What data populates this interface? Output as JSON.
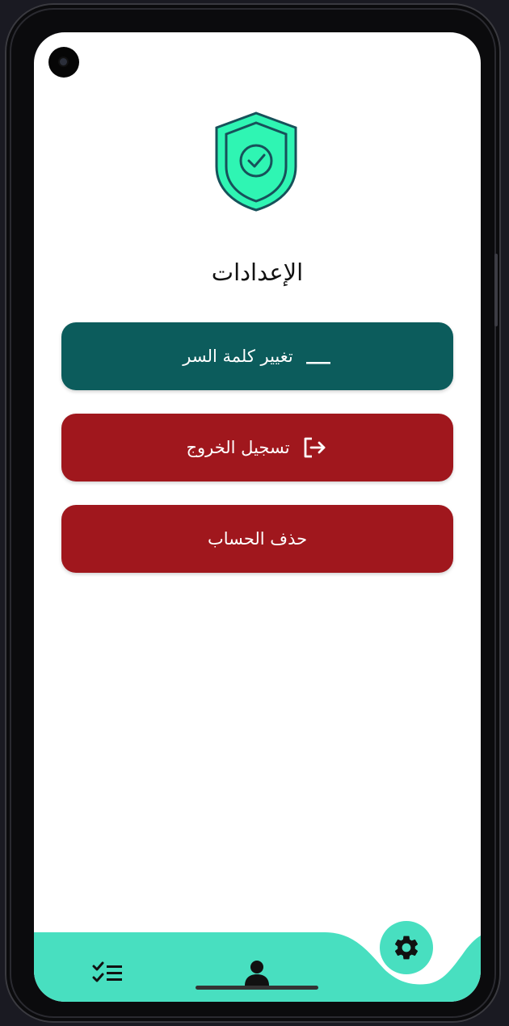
{
  "screen": {
    "title": "الإعدادات",
    "logo_icon": "shield-check-icon"
  },
  "actions": {
    "change_password": {
      "label": "تغيير كلمة السر",
      "icon": "password-dots-icon",
      "color": "#0c5c5c"
    },
    "logout": {
      "label": "تسجيل الخروج",
      "icon": "logout-icon",
      "color": "#a0171d"
    },
    "delete_account": {
      "label": "حذف الحساب",
      "color": "#a0171d"
    }
  },
  "bottom_nav": {
    "background": "#48dfc0",
    "items": [
      {
        "icon": "task-list-icon",
        "active": false
      },
      {
        "icon": "user-icon",
        "active": false
      },
      {
        "icon": "gear-icon",
        "active": true
      }
    ]
  }
}
